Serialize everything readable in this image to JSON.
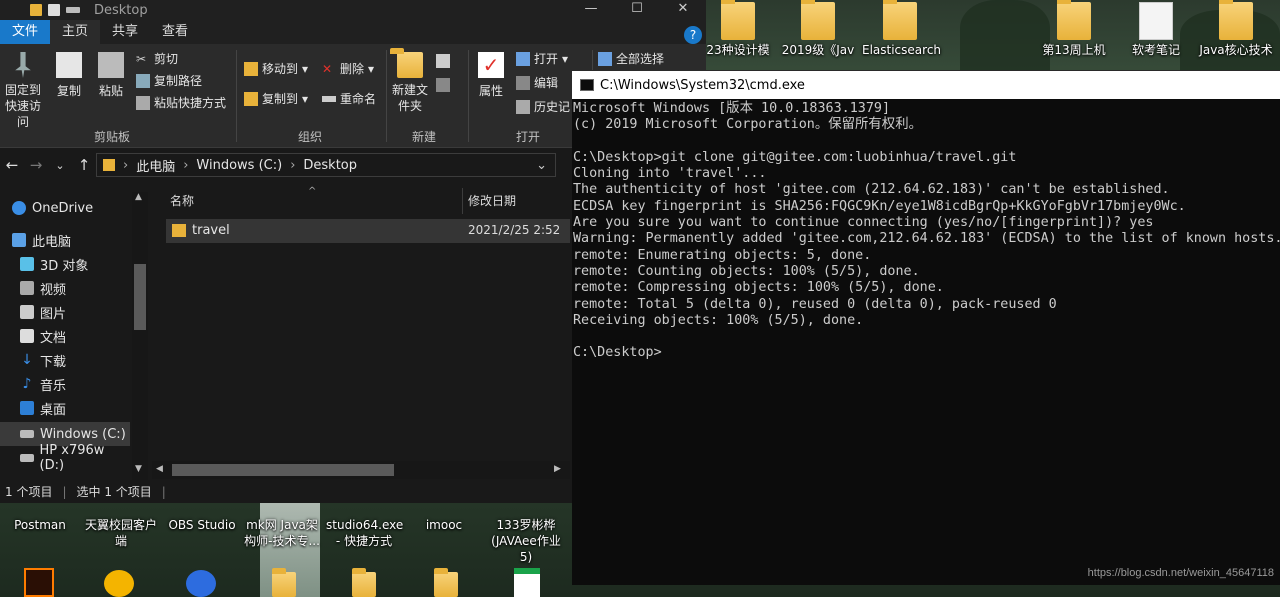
{
  "explorer": {
    "title": "Desktop",
    "tabs": [
      {
        "label": "文件"
      },
      {
        "label": "主页"
      },
      {
        "label": "共享"
      },
      {
        "label": "查看"
      }
    ],
    "ribbon": {
      "pin_label": "固定到快速访问",
      "copy_label": "复制",
      "paste_label": "粘贴",
      "cut_label": "剪切",
      "copy_path_label": "复制路径",
      "paste_shortcut_label": "粘贴快捷方式",
      "clipboard_group": "剪贴板",
      "move_to_label": "移动到",
      "copy_to_label": "复制到",
      "delete_label": "删除",
      "rename_label": "重命名",
      "organize_group": "组织",
      "new_folder_label": "新建文件夹",
      "new_group": "新建",
      "properties_label": "属性",
      "open_label": "打开",
      "edit_label": "编辑",
      "history_label": "历史记",
      "open_group": "打开",
      "select_all_label": "全部选择"
    },
    "address": {
      "crumbs": [
        "此电脑",
        "Windows (C:)",
        "Desktop"
      ]
    },
    "sidebar": {
      "items": [
        {
          "label": "OneDrive"
        },
        {
          "label": "此电脑"
        },
        {
          "label": "3D 对象"
        },
        {
          "label": "视频"
        },
        {
          "label": "图片"
        },
        {
          "label": "文档"
        },
        {
          "label": "下载"
        },
        {
          "label": "音乐"
        },
        {
          "label": "桌面"
        },
        {
          "label": "Windows (C:)"
        },
        {
          "label": "HP x796w (D:)"
        }
      ]
    },
    "columns": {
      "name": "名称",
      "date": "修改日期"
    },
    "files": [
      {
        "name": "travel",
        "date": "2021/2/25 2:52"
      }
    ],
    "status": {
      "count": "1 个项目",
      "selected": "选中 1 个项目"
    }
  },
  "desktop_icons": [
    {
      "label": "23种设计模"
    },
    {
      "label": "2019级《Jav"
    },
    {
      "label": "Elasticsearch"
    },
    {
      "label": "第13周上机"
    },
    {
      "label": "软考笔记"
    },
    {
      "label": "Java核心技术"
    },
    {
      "label": "Postman"
    },
    {
      "label": "天翼校园客户端"
    },
    {
      "label": "OBS Studio"
    },
    {
      "label": "mk网 Java架构师-技术专..."
    },
    {
      "label": "studio64.exe - 快捷方式"
    },
    {
      "label": "imooc"
    },
    {
      "label": "133罗彬桦(JAVAee作业5)"
    }
  ],
  "cmd": {
    "title": "C:\\Windows\\System32\\cmd.exe",
    "lines": [
      "Microsoft Windows [版本 10.0.18363.1379]",
      "(c) 2019 Microsoft Corporation。保留所有权利。",
      "",
      "C:\\Desktop>git clone git@gitee.com:luobinhua/travel.git",
      "Cloning into 'travel'...",
      "The authenticity of host 'gitee.com (212.64.62.183)' can't be established.",
      "ECDSA key fingerprint is SHA256:FQGC9Kn/eye1W8icdBgrQp+KkGYoFgbVr17bmjey0Wc.",
      "Are you sure you want to continue connecting (yes/no/[fingerprint])? yes",
      "Warning: Permanently added 'gitee.com,212.64.62.183' (ECDSA) to the list of known hosts.",
      "remote: Enumerating objects: 5, done.",
      "remote: Counting objects: 100% (5/5), done.",
      "remote: Compressing objects: 100% (5/5), done.",
      "remote: Total 5 (delta 0), reused 0 (delta 0), pack-reused 0",
      "Receiving objects: 100% (5/5), done.",
      "",
      "C:\\Desktop>"
    ]
  },
  "watermark": "https://blog.csdn.net/weixin_45647118",
  "colors": {
    "file_tab": "#1979ca",
    "console_bg": "#0c0c0c",
    "console_fg": "#cccccc",
    "folder": "#e8b23a"
  }
}
